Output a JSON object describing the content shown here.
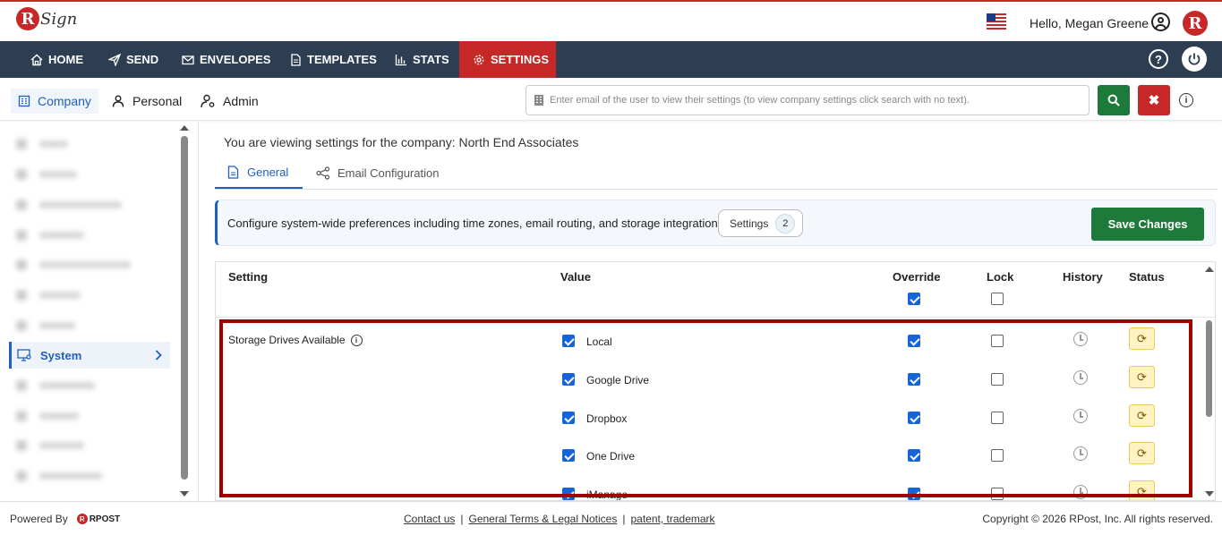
{
  "header": {
    "logo_letter": "R",
    "logo_text": "Sign",
    "greeting": "Hello, Megan Greene",
    "brand_letter": "R"
  },
  "nav": {
    "items": [
      {
        "label": "HOME",
        "icon": "home-icon"
      },
      {
        "label": "SEND",
        "icon": "send-icon"
      },
      {
        "label": "ENVELOPES",
        "icon": "envelope-icon"
      },
      {
        "label": "TEMPLATES",
        "icon": "document-icon"
      },
      {
        "label": "STATS",
        "icon": "bar-chart-icon"
      },
      {
        "label": "SETTINGS",
        "icon": "gear-icon",
        "active": true
      }
    ],
    "help_glyph": "?",
    "colors": {
      "nav_bg": "#2e3e52",
      "active_bg": "#c62828"
    }
  },
  "subtabs": {
    "company": "Company",
    "personal": "Personal",
    "admin": "Admin"
  },
  "search": {
    "placeholder": "Enter email of the user to view their settings (to view company settings click search with no text).",
    "clear_glyph": "✖",
    "info_glyph": "i"
  },
  "sidebar": {
    "active_label": "System"
  },
  "main": {
    "viewing_prefix": "You are viewing settings for the company:",
    "company_name": "North End Associates",
    "tabs": {
      "general": "General",
      "email_config": "Email Configuration"
    },
    "banner": {
      "text": "Configure system-wide preferences including time zones, email routing, and storage integrations.",
      "settings_label": "Settings",
      "settings_count": "2",
      "save_label": "Save Changes"
    }
  },
  "table": {
    "headers": {
      "setting": "Setting",
      "value": "Value",
      "override": "Override",
      "lock": "Lock",
      "history": "History",
      "status": "Status"
    },
    "header_override_checked": true,
    "header_lock_checked": false,
    "row_label": "Storage Drives Available",
    "info_glyph": "i",
    "drives": [
      {
        "name": "Local",
        "checked": true,
        "override": true,
        "lock": false
      },
      {
        "name": "Google Drive",
        "checked": true,
        "override": true,
        "lock": false
      },
      {
        "name": "Dropbox",
        "checked": true,
        "override": true,
        "lock": false
      },
      {
        "name": "One Drive",
        "checked": true,
        "override": true,
        "lock": false
      },
      {
        "name": "iManage",
        "checked": true,
        "override": true,
        "lock": false
      }
    ],
    "status_glyph": "⟳"
  },
  "footer": {
    "powered_by": "Powered By",
    "rpost_letter": "R",
    "rpost_text": "RPOST",
    "links": [
      "Contact us",
      "General Terms & Legal Notices",
      "patent, trademark"
    ],
    "separator": "|",
    "copyright": "Copyright © 2026 RPost, Inc. All rights reserved."
  }
}
